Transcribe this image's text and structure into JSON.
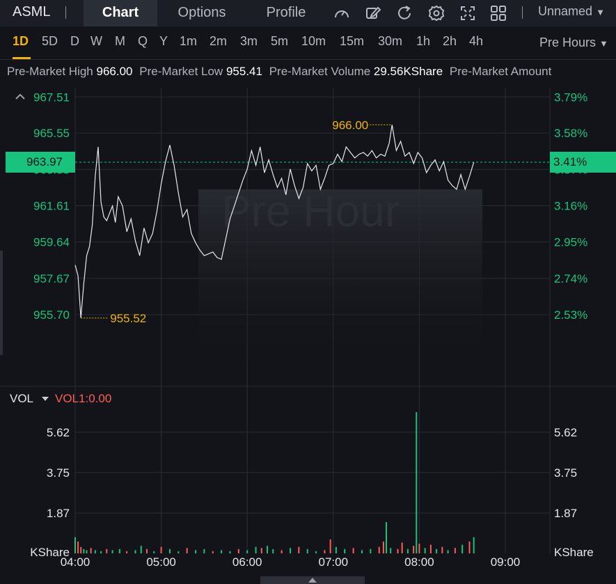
{
  "header": {
    "ticker": "ASML",
    "tabs": [
      {
        "label": "Chart",
        "active": true
      },
      {
        "label": "Options",
        "active": false
      },
      {
        "label": "Profile",
        "active": false
      }
    ],
    "tool_icons": [
      "gauge-icon",
      "pencil-icon",
      "refresh-icon",
      "gear-icon",
      "expand-icon",
      "grid-icon"
    ],
    "layout_name": "Unnamed"
  },
  "intervals": {
    "items": [
      "1D",
      "5D",
      "D",
      "W",
      "M",
      "Q",
      "Y",
      "1m",
      "2m",
      "3m",
      "5m",
      "10m",
      "15m",
      "30m",
      "1h",
      "2h",
      "4h"
    ],
    "active": "1D",
    "session": "Pre Hours"
  },
  "stats": {
    "high_label": "Pre-Market High",
    "high_value": "966.00",
    "low_label": "Pre-Market Low",
    "low_value": "955.41",
    "volume_label": "Pre-Market Volume",
    "volume_value": "29.56KShare",
    "amount_label": "Pre-Market Amount"
  },
  "colors": {
    "up": "#19c37d",
    "down": "#ff5e57",
    "accent": "#f2b400",
    "line": "#e8eaee"
  },
  "chart_data": [
    {
      "type": "line",
      "watermark": "Pre Hour",
      "price_ticks": [
        "967.51",
        "965.55",
        "963.58",
        "961.61",
        "959.64",
        "957.67",
        "955.70"
      ],
      "percent_ticks": [
        "3.79%",
        "3.58%",
        "3.37%",
        "3.16%",
        "2.95%",
        "2.74%",
        "2.53%"
      ],
      "ylim": [
        955.0,
        968.2
      ],
      "xlim": [
        "04:00",
        "09:00"
      ],
      "time_ticks": [
        "04:00",
        "05:00",
        "06:00",
        "07:00",
        "08:00",
        "09:00"
      ],
      "current_price": "963.97",
      "current_percent": "3.41%",
      "high_marker": {
        "label": "966.00",
        "time": "07:41",
        "value": 966.0
      },
      "low_marker": {
        "label": "955.52",
        "time": "04:04",
        "value": 955.52
      },
      "series": [
        {
          "x": [
            "04:00",
            "04:02",
            "04:04",
            "04:06",
            "04:08",
            "04:10",
            "04:12",
            "04:14",
            "04:16",
            "04:18",
            "04:20",
            "04:22",
            "04:24",
            "04:26",
            "04:28",
            "04:30",
            "04:33",
            "04:36",
            "04:39",
            "04:42",
            "04:45",
            "04:48",
            "04:51",
            "04:54",
            "04:57",
            "05:00",
            "05:03",
            "05:06",
            "05:09",
            "05:12",
            "05:15",
            "05:18",
            "05:21",
            "05:24",
            "05:27",
            "05:30",
            "05:33",
            "05:36",
            "05:39",
            "05:42",
            "05:45",
            "05:48",
            "05:51",
            "05:54",
            "05:57",
            "06:00",
            "06:03",
            "06:06",
            "06:09",
            "06:12",
            "06:15",
            "06:18",
            "06:21",
            "06:24",
            "06:27",
            "06:30",
            "06:33",
            "06:36",
            "06:39",
            "06:42",
            "06:45",
            "06:48",
            "06:51",
            "06:54",
            "06:57",
            "07:00",
            "07:03",
            "07:06",
            "07:09",
            "07:12",
            "07:15",
            "07:18",
            "07:21",
            "07:24",
            "07:27",
            "07:30",
            "07:33",
            "07:36",
            "07:39",
            "07:41",
            "07:44",
            "07:47",
            "07:50",
            "07:53",
            "07:56",
            "07:59",
            "08:02",
            "08:05",
            "08:08",
            "08:11",
            "08:14",
            "08:17",
            "08:20",
            "08:23",
            "08:26",
            "08:29",
            "08:32",
            "08:35",
            "08:38"
          ],
          "values": [
            958.4,
            957.8,
            955.52,
            957.4,
            958.9,
            959.4,
            960.6,
            963.2,
            964.8,
            961.8,
            961.0,
            960.8,
            961.2,
            961.6,
            960.7,
            962.1,
            961.6,
            960.2,
            960.9,
            959.7,
            958.9,
            960.4,
            959.6,
            960.1,
            961.3,
            962.8,
            964.0,
            964.9,
            963.8,
            962.3,
            961.0,
            961.4,
            960.1,
            959.6,
            959.2,
            958.9,
            959.0,
            959.1,
            958.8,
            958.7,
            959.8,
            960.9,
            961.6,
            962.3,
            963.0,
            963.6,
            964.6,
            963.8,
            964.8,
            963.4,
            964.1,
            963.3,
            962.6,
            963.1,
            962.2,
            963.6,
            962.7,
            962.0,
            962.6,
            963.9,
            963.5,
            963.8,
            962.5,
            963.1,
            963.8,
            963.9,
            964.4,
            964.0,
            964.8,
            964.5,
            964.2,
            964.4,
            964.5,
            964.3,
            964.6,
            964.2,
            964.4,
            964.3,
            965.0,
            966.0,
            964.6,
            965.1,
            964.3,
            964.5,
            963.9,
            964.5,
            964.2,
            963.4,
            963.8,
            964.1,
            963.5,
            964.0,
            963.0,
            962.7,
            962.5,
            963.3,
            962.5,
            963.2,
            963.97
          ]
        }
      ]
    },
    {
      "type": "bar",
      "title": "VOL",
      "subtitle": "VOL1:0.00",
      "unit": "KShare",
      "ticks": [
        "5.62",
        "3.75",
        "1.87"
      ],
      "ylim": [
        0,
        7.1
      ],
      "bars": [
        {
          "t": "04:00",
          "v": 0.75,
          "d": "up"
        },
        {
          "t": "04:02",
          "v": 0.55,
          "d": "down"
        },
        {
          "t": "04:04",
          "v": 0.3,
          "d": "down"
        },
        {
          "t": "04:06",
          "v": 0.2,
          "d": "up"
        },
        {
          "t": "04:08",
          "v": 0.15,
          "d": "up"
        },
        {
          "t": "04:11",
          "v": 0.25,
          "d": "down"
        },
        {
          "t": "04:14",
          "v": 0.15,
          "d": "up"
        },
        {
          "t": "04:18",
          "v": 0.1,
          "d": "up"
        },
        {
          "t": "04:22",
          "v": 0.2,
          "d": "down"
        },
        {
          "t": "04:26",
          "v": 0.15,
          "d": "up"
        },
        {
          "t": "04:31",
          "v": 0.2,
          "d": "up"
        },
        {
          "t": "04:36",
          "v": 0.1,
          "d": "down"
        },
        {
          "t": "04:42",
          "v": 0.15,
          "d": "up"
        },
        {
          "t": "04:46",
          "v": 0.35,
          "d": "up"
        },
        {
          "t": "04:50",
          "v": 0.2,
          "d": "down"
        },
        {
          "t": "04:55",
          "v": 0.1,
          "d": "up"
        },
        {
          "t": "05:00",
          "v": 0.3,
          "d": "down"
        },
        {
          "t": "05:06",
          "v": 0.2,
          "d": "up"
        },
        {
          "t": "05:12",
          "v": 0.1,
          "d": "up"
        },
        {
          "t": "05:18",
          "v": 0.25,
          "d": "down"
        },
        {
          "t": "05:24",
          "v": 0.15,
          "d": "up"
        },
        {
          "t": "05:30",
          "v": 0.2,
          "d": "up"
        },
        {
          "t": "05:36",
          "v": 0.1,
          "d": "down"
        },
        {
          "t": "05:42",
          "v": 0.15,
          "d": "up"
        },
        {
          "t": "05:48",
          "v": 0.1,
          "d": "up"
        },
        {
          "t": "05:54",
          "v": 0.2,
          "d": "down"
        },
        {
          "t": "06:00",
          "v": 0.15,
          "d": "up"
        },
        {
          "t": "06:06",
          "v": 0.3,
          "d": "up"
        },
        {
          "t": "06:10",
          "v": 0.25,
          "d": "down"
        },
        {
          "t": "06:14",
          "v": 0.35,
          "d": "up"
        },
        {
          "t": "06:18",
          "v": 0.2,
          "d": "up"
        },
        {
          "t": "06:24",
          "v": 0.15,
          "d": "down"
        },
        {
          "t": "06:30",
          "v": 0.25,
          "d": "up"
        },
        {
          "t": "06:36",
          "v": 0.3,
          "d": "down"
        },
        {
          "t": "06:42",
          "v": 0.2,
          "d": "up"
        },
        {
          "t": "06:48",
          "v": 0.1,
          "d": "up"
        },
        {
          "t": "06:54",
          "v": 0.15,
          "d": "down"
        },
        {
          "t": "06:58",
          "v": 0.65,
          "d": "down"
        },
        {
          "t": "07:02",
          "v": 0.3,
          "d": "up"
        },
        {
          "t": "07:08",
          "v": 0.2,
          "d": "up"
        },
        {
          "t": "07:14",
          "v": 0.25,
          "d": "down"
        },
        {
          "t": "07:20",
          "v": 0.15,
          "d": "up"
        },
        {
          "t": "07:26",
          "v": 0.2,
          "d": "up"
        },
        {
          "t": "07:32",
          "v": 0.3,
          "d": "down"
        },
        {
          "t": "07:35",
          "v": 0.55,
          "d": "down"
        },
        {
          "t": "07:37",
          "v": 1.45,
          "d": "up"
        },
        {
          "t": "07:40",
          "v": 0.25,
          "d": "up"
        },
        {
          "t": "07:45",
          "v": 0.2,
          "d": "down"
        },
        {
          "t": "07:48",
          "v": 0.5,
          "d": "down"
        },
        {
          "t": "07:52",
          "v": 0.2,
          "d": "up"
        },
        {
          "t": "07:56",
          "v": 0.35,
          "d": "down"
        },
        {
          "t": "08:00",
          "v": 0.45,
          "d": "down"
        },
        {
          "t": "07:58",
          "v": 6.55,
          "d": "up"
        },
        {
          "t": "08:04",
          "v": 0.25,
          "d": "up"
        },
        {
          "t": "08:08",
          "v": 0.4,
          "d": "down"
        },
        {
          "t": "08:12",
          "v": 0.2,
          "d": "up"
        },
        {
          "t": "08:16",
          "v": 0.3,
          "d": "down"
        },
        {
          "t": "08:20",
          "v": 0.15,
          "d": "up"
        },
        {
          "t": "08:25",
          "v": 0.25,
          "d": "down"
        },
        {
          "t": "08:30",
          "v": 0.4,
          "d": "up"
        },
        {
          "t": "08:35",
          "v": 0.55,
          "d": "down"
        },
        {
          "t": "08:38",
          "v": 0.75,
          "d": "up"
        }
      ]
    }
  ]
}
